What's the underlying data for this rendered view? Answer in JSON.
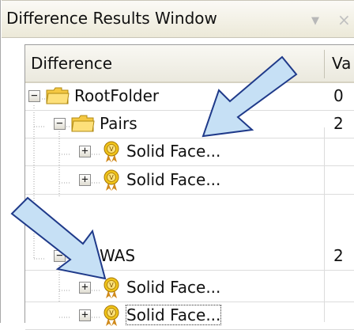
{
  "window": {
    "title": "Difference Results Window",
    "dropdown_glyph": "▼",
    "close_glyph": "×"
  },
  "columns": {
    "difference": "Difference",
    "value": "Va"
  },
  "tree": [
    {
      "label": "RootFolder",
      "value": "0",
      "icon": "folder-icon",
      "expander": "−"
    },
    {
      "label": "Pairs",
      "value": "2",
      "icon": "folder-icon",
      "expander": "−"
    },
    {
      "label": "Solid Face...",
      "value": "",
      "icon": "medal-icon",
      "expander": "+"
    },
    {
      "label": "Solid Face...",
      "value": "",
      "icon": "medal-icon",
      "expander": "+"
    },
    {
      "label": "WAS",
      "value": "2",
      "icon": "folder-icon",
      "expander": "−"
    },
    {
      "label": "Solid Face...",
      "value": "",
      "icon": "medal-icon",
      "expander": "+"
    },
    {
      "label": "Solid Face...",
      "value": "",
      "icon": "medal-icon",
      "expander": "+"
    }
  ],
  "colors": {
    "arrow_fill": "#c6e0f5",
    "arrow_stroke": "#1f3a8a",
    "folder": "#f5c842",
    "medal": "#f0c419"
  }
}
